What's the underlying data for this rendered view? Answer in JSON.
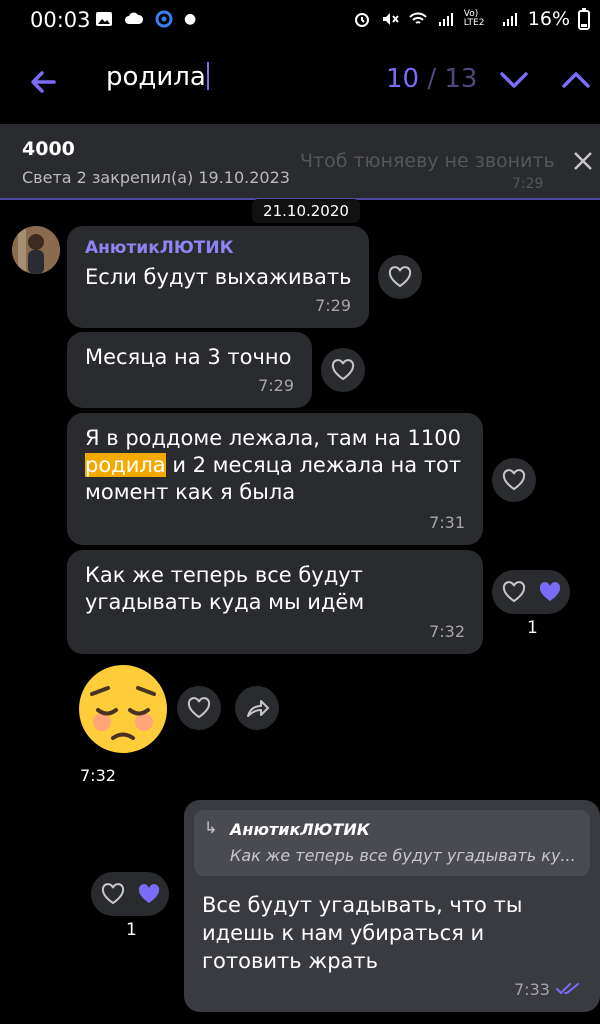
{
  "status_bar": {
    "time": "00:03",
    "battery": "16%",
    "network": "Vo) LTE2"
  },
  "search": {
    "query": "родила",
    "current": "10",
    "separator": "/",
    "total": "13"
  },
  "pinned": {
    "title": "4000",
    "subtitle": "Света 2 закрепил(а) 19.10.2023",
    "behind_text": "Чтоб тюняеву не звонить",
    "behind_time": "7:29"
  },
  "date_chip": "21.10.2020",
  "messages": [
    {
      "sender": "АнютикЛЮТИК",
      "text": "Если будут выхаживать",
      "time": "7:29"
    },
    {
      "text": "Месяца на 3 точно",
      "time": "7:29"
    },
    {
      "text_before": "Я в роддоме лежала, там на 1100",
      "highlight": "родила",
      "text_after": " и 2 месяца лежала на тот",
      "text_line3": "момент как я была",
      "time": "7:31"
    },
    {
      "line1": "Как же теперь все будут",
      "line2": "угадывать куда мы идём",
      "time": "7:32",
      "reaction_count": "1"
    },
    {
      "emoji": "😔",
      "time": "7:32"
    }
  ],
  "outgoing": {
    "reply_name": "АнютикЛЮТИК",
    "reply_text": "Как же теперь все будут угадывать ку...",
    "line1": "Все будут угадывать, что ты",
    "line2": "идешь к нам убираться и",
    "line3": "готовить жрать",
    "time": "7:33",
    "reaction_count": "1"
  },
  "colors": {
    "accent": "#7b6cf6",
    "bubble": "#2a2b2f",
    "highlight": "#f2a900"
  }
}
